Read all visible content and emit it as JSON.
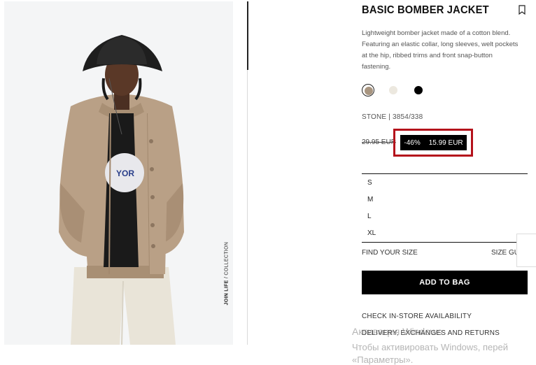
{
  "product": {
    "title": "BASIC BOMBER JACKET",
    "description": "Lightweight bomber jacket made of a cotton blend. Featuring an elastic collar, long sleeves, welt pockets at the hip, ribbed trims and front snap-button fastening.",
    "color_ref": "STONE | 3854/338",
    "old_price": "29.95 EUR",
    "discount": "-46%",
    "price": "15.99 EUR",
    "collection_bold": "JOIN LIFE",
    "collection_rest": " / COLLECTION"
  },
  "colors": [
    {
      "name": "stone",
      "hex": "#a89580",
      "selected": true
    },
    {
      "name": "ecru",
      "hex": "#ece8df",
      "selected": false
    },
    {
      "name": "black",
      "hex": "#000000",
      "selected": false
    }
  ],
  "sizes": [
    "S",
    "M",
    "L",
    "XL"
  ],
  "find_size": "FIND YOUR SIZE",
  "size_guide": "SIZE GU",
  "add_to_bag": "ADD TO BAG",
  "links": {
    "store": "CHECK IN-STORE AVAILABILITY",
    "delivery": "DELIVERY, EXCHANGES AND RETURNS"
  },
  "watermark": {
    "line1": "Активация Windows",
    "line2": "Чтобы активировать Windows, перей",
    "line3": "«Параметры»."
  },
  "icons": {
    "bookmark": "bookmark-icon"
  }
}
